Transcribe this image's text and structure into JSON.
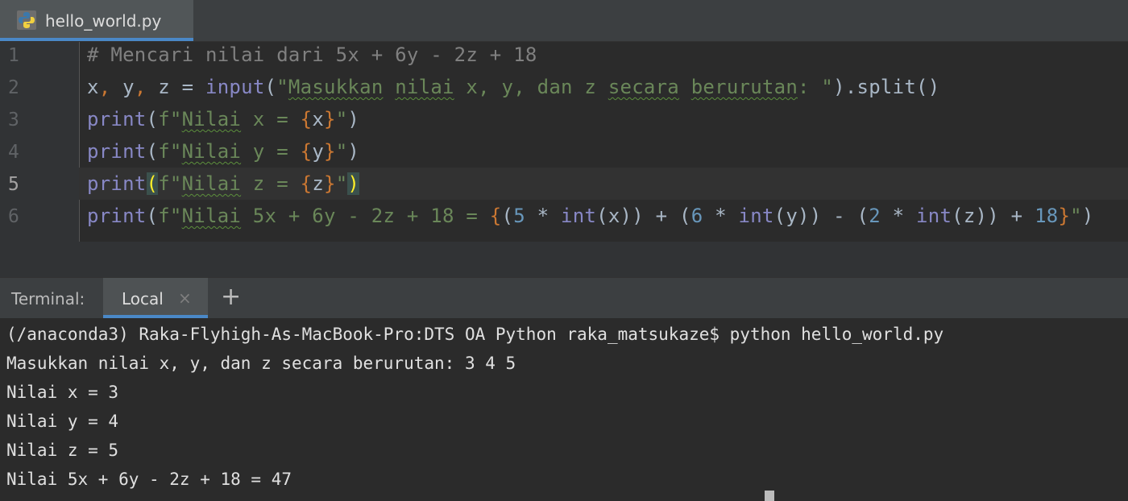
{
  "editor_tab": {
    "filename": "hello_world.py",
    "icon": "python-file-icon"
  },
  "editor": {
    "line_numbers": [
      "1",
      "2",
      "3",
      "4",
      "5",
      "6"
    ],
    "active_line": "5",
    "l1": {
      "comment": "# Mencari nilai dari 5x + 6y - 2z + 18"
    },
    "l2": {
      "x": "x",
      "c1": ",",
      "y": " y",
      "c2": ",",
      "z": " z = ",
      "fn": "input",
      "po": "(",
      "s1": "\"",
      "s2": "Masukkan",
      "s3": " ",
      "s4": "nilai",
      "s5": " x, y, dan z ",
      "s6": "secara",
      "s7": " ",
      "s8": "berurutan",
      "s9": ": \"",
      "pc": ").split()"
    },
    "l3": {
      "fn": "print",
      "po": "(",
      "s1": "f\"",
      "s2": "Nilai",
      "s3": " x = ",
      "bo": "{",
      "v": "x",
      "bc": "}",
      "s4": "\"",
      "pc": ")"
    },
    "l4": {
      "fn": "print",
      "po": "(",
      "s1": "f\"",
      "s2": "Nilai",
      "s3": " y = ",
      "bo": "{",
      "v": "y",
      "bc": "}",
      "s4": "\"",
      "pc": ")"
    },
    "l5": {
      "fn": "print",
      "po": "(",
      "s1": "f\"",
      "s2": "Nilai",
      "s3": " z = ",
      "bo": "{",
      "v": "z",
      "bc": "}",
      "s4": "\"",
      "pc": ")"
    },
    "l6": {
      "fn": "print",
      "po": "(",
      "s1": "f\"",
      "s2": "Nilai",
      "s3": " 5x + 6y - 2z + 18 = ",
      "bo": "{",
      "p1": "(",
      "n1": "5",
      "p2": " * ",
      "f1": "int",
      "p3": "(x)) + (",
      "n2": "6",
      "p4": " * ",
      "f2": "int",
      "p5": "(y)) - (",
      "n3": "2",
      "p6": " * ",
      "f3": "int",
      "p7": "(z)) + ",
      "n4": "18",
      "bc": "}",
      "s4": "\"",
      "pc": ")"
    }
  },
  "terminal": {
    "title": "Terminal:",
    "tab_label": "Local",
    "close_glyph": "×",
    "add_glyph": "+",
    "lines": [
      "(/anaconda3) Raka-Flyhigh-As-MacBook-Pro:DTS OA Python raka_matsukaze$ python hello_world.py",
      "Masukkan nilai x, y, dan z secara berurutan: 3 4 5",
      "Nilai x = 3",
      "Nilai y = 4",
      "Nilai z = 5",
      "Nilai 5x + 6y - 2z + 18 = 47"
    ]
  },
  "colors": {
    "background": "#2b2b2b",
    "keyword": "#8888c6",
    "string": "#6a8759",
    "brace": "#cc7832",
    "number": "#6897bb",
    "comment": "#808080",
    "tab_accent": "#4a88c7"
  }
}
